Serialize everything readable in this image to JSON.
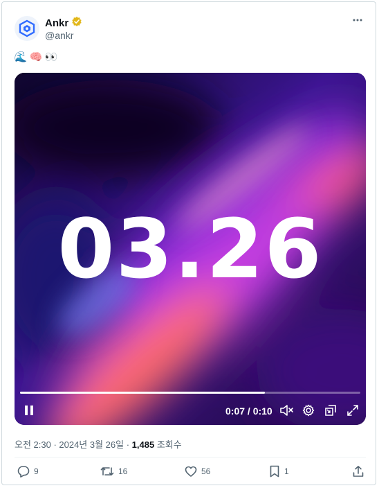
{
  "author": {
    "name": "Ankr",
    "handle": "@ankr"
  },
  "tweet": {
    "emojis": [
      "🌊",
      "🧠",
      "👀"
    ]
  },
  "video": {
    "overlay_text": "03.26",
    "time": "0:07 / 0:10",
    "progress": 0.72
  },
  "meta": {
    "timestamp": "오전 2:30 · 2024년 3월 26일 · ",
    "views_count": "1,485",
    "views_label": " 조회수"
  },
  "actions": {
    "replies": "9",
    "retweets": "16",
    "likes": "56",
    "bookmarks": "1"
  },
  "colors": {
    "verified": "#e2b719",
    "brand": "#3375ff"
  }
}
